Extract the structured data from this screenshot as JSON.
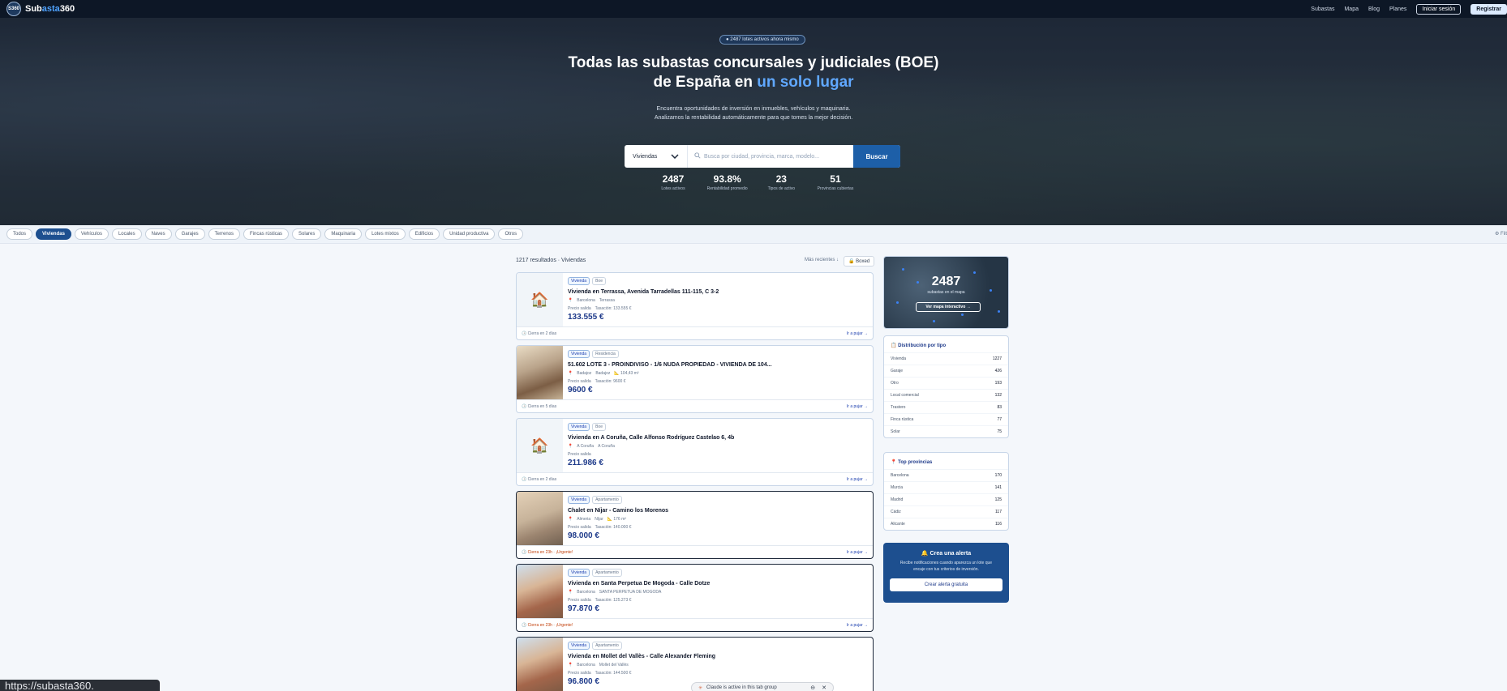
{
  "nav": {
    "logo_badge": "S360",
    "logo_part1": "Sub",
    "logo_part2": "asta",
    "logo_part3": "360",
    "links": [
      "Subastas",
      "Mapa",
      "Blog",
      "Planes"
    ],
    "login": "Iniciar sesión",
    "register": "Registrar"
  },
  "hero": {
    "pill": "● 2487 lotes activos ahora mismo",
    "title_line1": "Todas las subastas concursales y judiciales (BOE)",
    "title_line2_pre": "de España en ",
    "title_line2_hl": "un solo lugar",
    "subtitle": "Encuentra oportunidades de inversión en inmuebles, vehículos y maquinaria. Analizamos la rentabilidad automáticamente para que tomes la mejor decisión.",
    "search_category": "Viviendas",
    "search_placeholder": "Busca por ciudad, provincia, marca, modelo...",
    "search_button": "Buscar",
    "stats": [
      {
        "value": "2487",
        "label": "Lotes activos"
      },
      {
        "value": "93.8%",
        "label": "Rentabilidad promedio"
      },
      {
        "value": "23",
        "label": "Tipos de activo"
      },
      {
        "value": "51",
        "label": "Provincias cubiertas"
      }
    ]
  },
  "filters": {
    "chips": [
      "Todos",
      "Viviendas",
      "Vehículos",
      "Locales",
      "Naves",
      "Garajes",
      "Terrenos",
      "Fincas rústicas",
      "Solares",
      "Maquinaria",
      "Lotes mixtos",
      "Edificios",
      "Unidad productiva",
      "Otros"
    ],
    "active": "Viviendas",
    "right": "⚙ Filt"
  },
  "results": {
    "header": "1217 resultados · Viviendas",
    "sort": "Más recientes ↓",
    "toggle": "🔒 Boxed",
    "cards": [
      {
        "tags": [
          "Vivienda",
          "Boe"
        ],
        "title": "Vivienda en Terrassa, Avenida Tarradellas 111-115, C 3-2",
        "location": [
          "Barcelona",
          "Terrassa"
        ],
        "meta": [
          "Precio salida",
          "Tasación: 133.555 €"
        ],
        "price": "133.555 €",
        "closes": "🕒 Cierra en 2 días",
        "bid": "Ir a pujar →"
      },
      {
        "tags": [
          "Vivienda",
          "Residencia"
        ],
        "title": "51.602 LOTE 3 - PROINDIVISO - 1/6 NUDA PROPIEDAD - VIVIENDA DE 104...",
        "location": [
          "Badajoz",
          "Badajoz",
          "📐 104,43 m²"
        ],
        "meta": [
          "Precio salida",
          "Tasación: 9600 €"
        ],
        "price": "9600 €",
        "closes": "🕒 Cierra en 5 días",
        "bid": "Ir a pujar →"
      },
      {
        "tags": [
          "Vivienda",
          "Boe"
        ],
        "title": "Vivienda en A Coruña, Calle Alfonso Rodríguez Castelao 6, 4b",
        "location": [
          "A Coruña",
          "A Coruña"
        ],
        "meta": [
          "Precio salida"
        ],
        "price": "211.986 €",
        "closes": "🕒 Cierra en 2 días",
        "bid": "Ir a pujar →"
      },
      {
        "tags": [
          "Vivienda",
          "Apartamento"
        ],
        "title": "Chalet en Níjar - Camino los Morenos",
        "location": [
          "Almeria",
          "Níjar",
          "📐 176 m²"
        ],
        "meta": [
          "Precio salida",
          "Tasación: 140.000 €"
        ],
        "price": "98.000 €",
        "closes": "🕒 Cierra en 23h · ¡Urgente!",
        "bid": "Ir a pujar →"
      },
      {
        "tags": [
          "Vivienda",
          "Apartamento"
        ],
        "title": "Vivienda en Santa Perpetua De Mogoda - Calle Dotze",
        "location": [
          "Barcelona",
          "SANTA PERPETUA DE MOGODA"
        ],
        "meta": [
          "Precio salida",
          "Tasación: 125.273 €"
        ],
        "price": "97.870 €",
        "closes": "🕒 Cierra en 23h · ¡Urgente!",
        "bid": "Ir a pujar →"
      },
      {
        "tags": [
          "Vivienda",
          "Apartamento"
        ],
        "title": "Vivienda en Mollet del Vallès - Calle Alexander Fleming",
        "location": [
          "Barcelona",
          "Mollet del Vallès"
        ],
        "meta": [
          "Precio salida",
          "Tasación: 144.500 €"
        ],
        "price": "96.800 €",
        "closes": "",
        "bid": ""
      }
    ]
  },
  "sidebar": {
    "map_count": "2487",
    "map_label": "subastas en el mapa",
    "map_button": "Ver mapa interactivo →",
    "distribution_title": "📋 Distribución por tipo",
    "distribution": [
      {
        "label": "Vivienda",
        "value": "1227"
      },
      {
        "label": "Garaje",
        "value": "426"
      },
      {
        "label": "Otro",
        "value": "193"
      },
      {
        "label": "Local comercial",
        "value": "132"
      },
      {
        "label": "Trastero",
        "value": "83"
      },
      {
        "label": "Finca rústica",
        "value": "77"
      },
      {
        "label": "Solar",
        "value": "75"
      }
    ],
    "provinces_title": "📍 Top provincias",
    "provinces": [
      {
        "label": "Barcelona",
        "value": "170"
      },
      {
        "label": "Murcia",
        "value": "141"
      },
      {
        "label": "Madrid",
        "value": "125"
      },
      {
        "label": "Cádiz",
        "value": "117"
      },
      {
        "label": "Alicante",
        "value": "116"
      }
    ],
    "alert_title": "🔔 Crea una alerta",
    "alert_text": "Recibe notificaciones cuando aparezca un lote que encaje con tus criterios de inversión.",
    "alert_button": "Crear alerta gratuita"
  },
  "overlays": {
    "url_tip": "https://subasta360.",
    "claude": "Claude is active in this tab group"
  }
}
